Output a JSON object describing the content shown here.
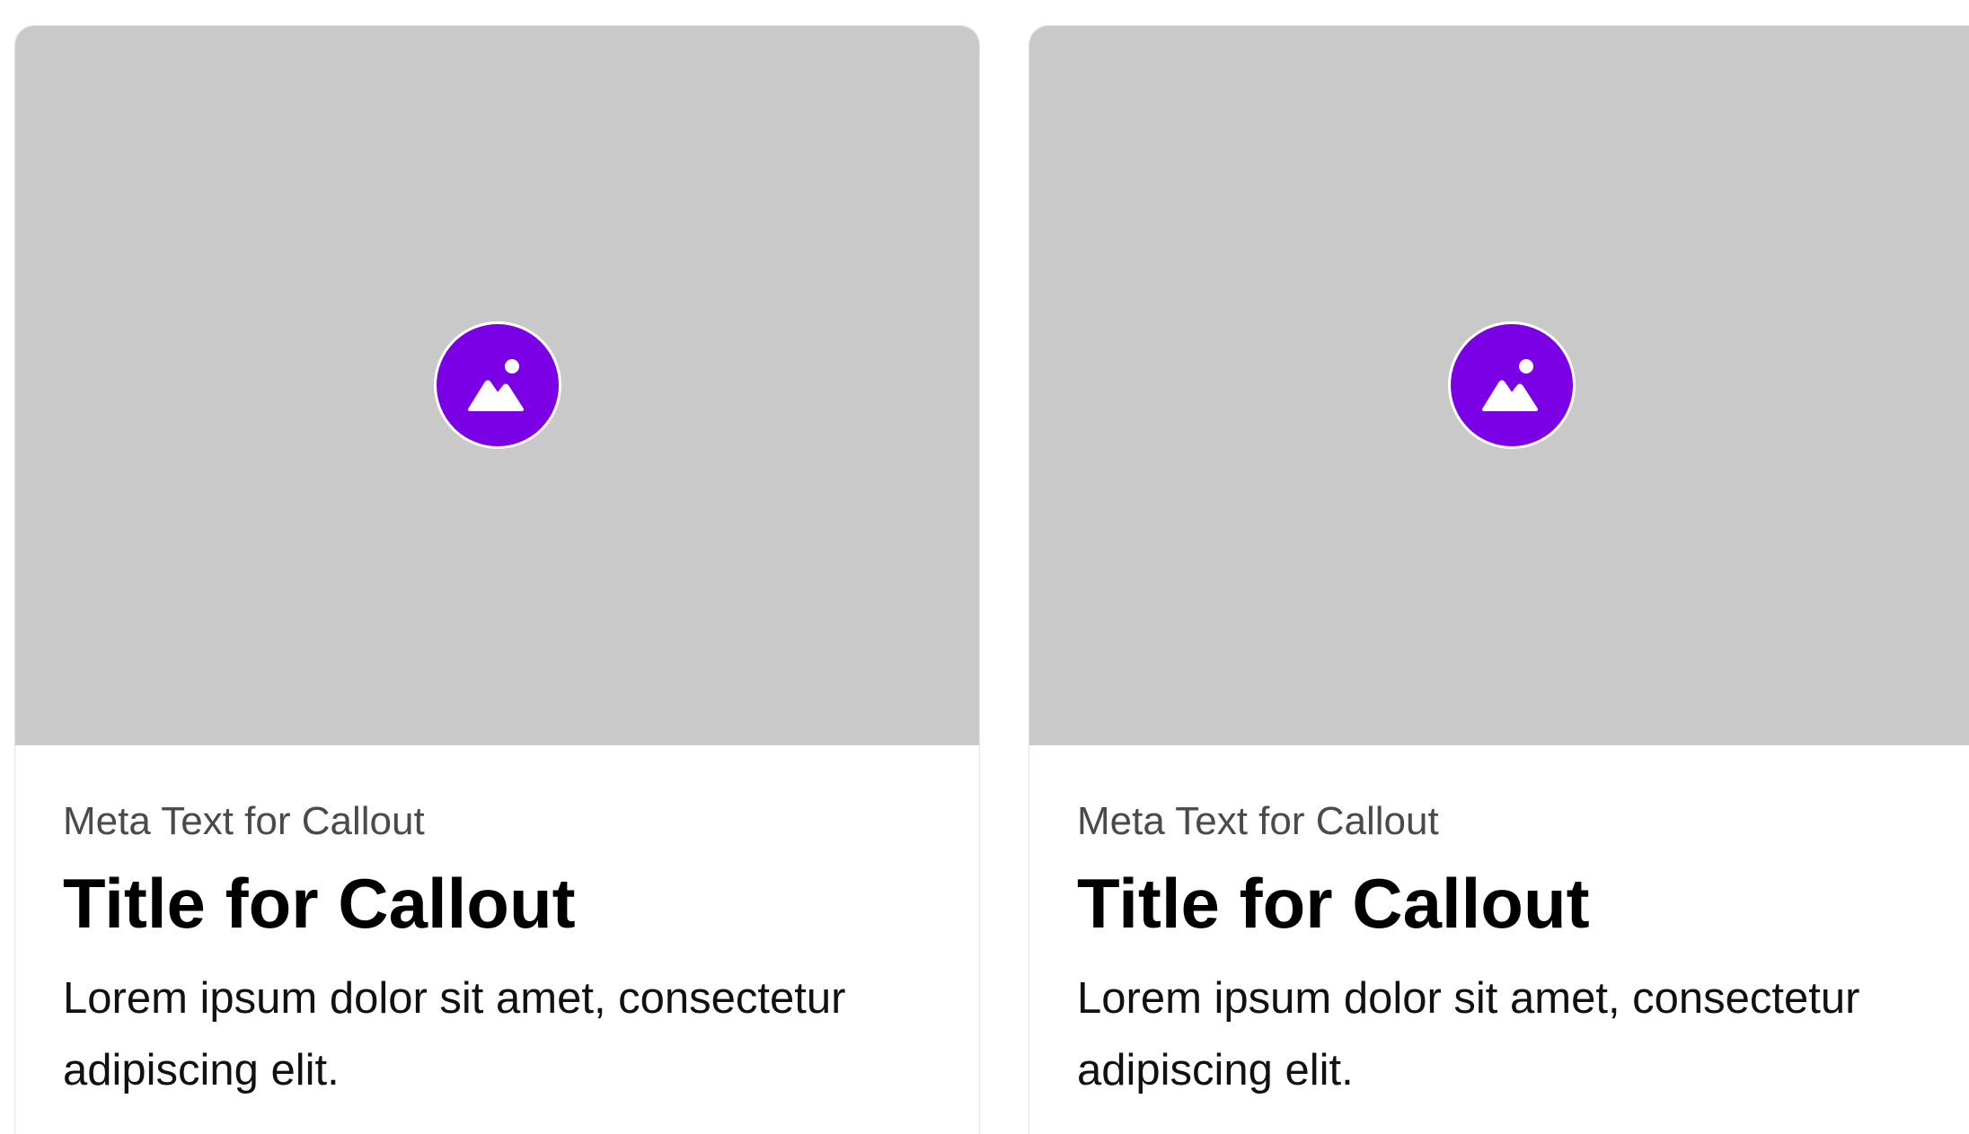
{
  "colors": {
    "badge": "#7b00e6",
    "media_placeholder": "#c9c9c9",
    "meta_text": "#4a4a4a"
  },
  "cards": [
    {
      "media_icon": "image-placeholder-icon",
      "meta": "Meta Text for Callout",
      "title": "Title for Callout",
      "description": "Lorem ipsum dolor sit amet, consectetur adipiscing elit."
    },
    {
      "media_icon": "image-placeholder-icon",
      "meta": "Meta Text for Callout",
      "title": "Title for Callout",
      "description": "Lorem ipsum dolor sit amet, consectetur adipiscing elit."
    }
  ]
}
